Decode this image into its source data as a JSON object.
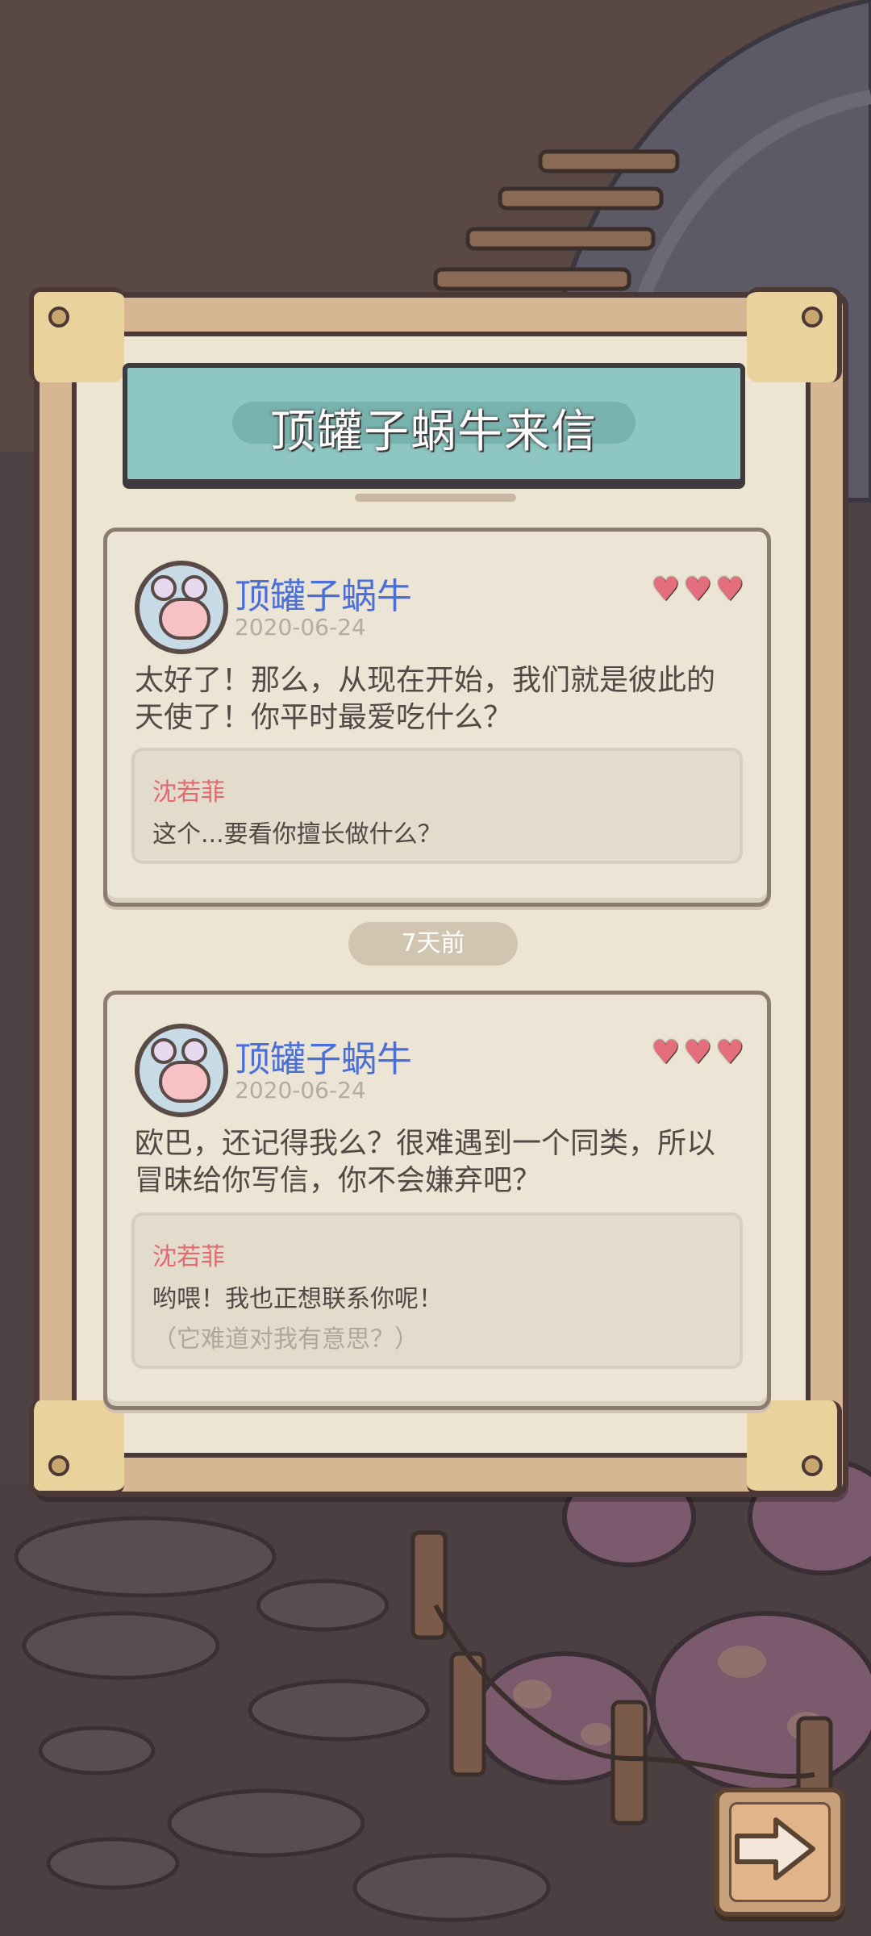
{
  "title": "顶罐子蜗牛来信",
  "letters": [
    {
      "sender": "顶罐子蜗牛",
      "date": "2020-06-24",
      "hearts": 3,
      "message_line1": "太好了！那么，从现在开始，我们就是彼此的",
      "message_line2": "天使了！你平时最爱吃什么？",
      "reply": {
        "name": "沈若菲",
        "text": "这个...要看你擅长做什么？"
      }
    },
    {
      "sender": "顶罐子蜗牛",
      "date": "2020-06-24",
      "hearts": 3,
      "message_line1": "欧巴，还记得我么？很难遇到一个同类，所以",
      "message_line2": "冒昧给你写信，你不会嫌弃吧？",
      "reply": {
        "name": "沈若菲",
        "text": "哟喂！我也正想联系你呢！",
        "thought": "（它难道对我有意思？）"
      }
    }
  ],
  "time_separator": "7天前",
  "icons": {
    "heart": "heart-icon",
    "next": "arrow-right-icon",
    "avatar": "snail-avatar"
  },
  "colors": {
    "sender": "#4a6fd7",
    "reply_name": "#e16a6d",
    "heart": "#e46e7c",
    "banner": "#8dc6c2"
  }
}
